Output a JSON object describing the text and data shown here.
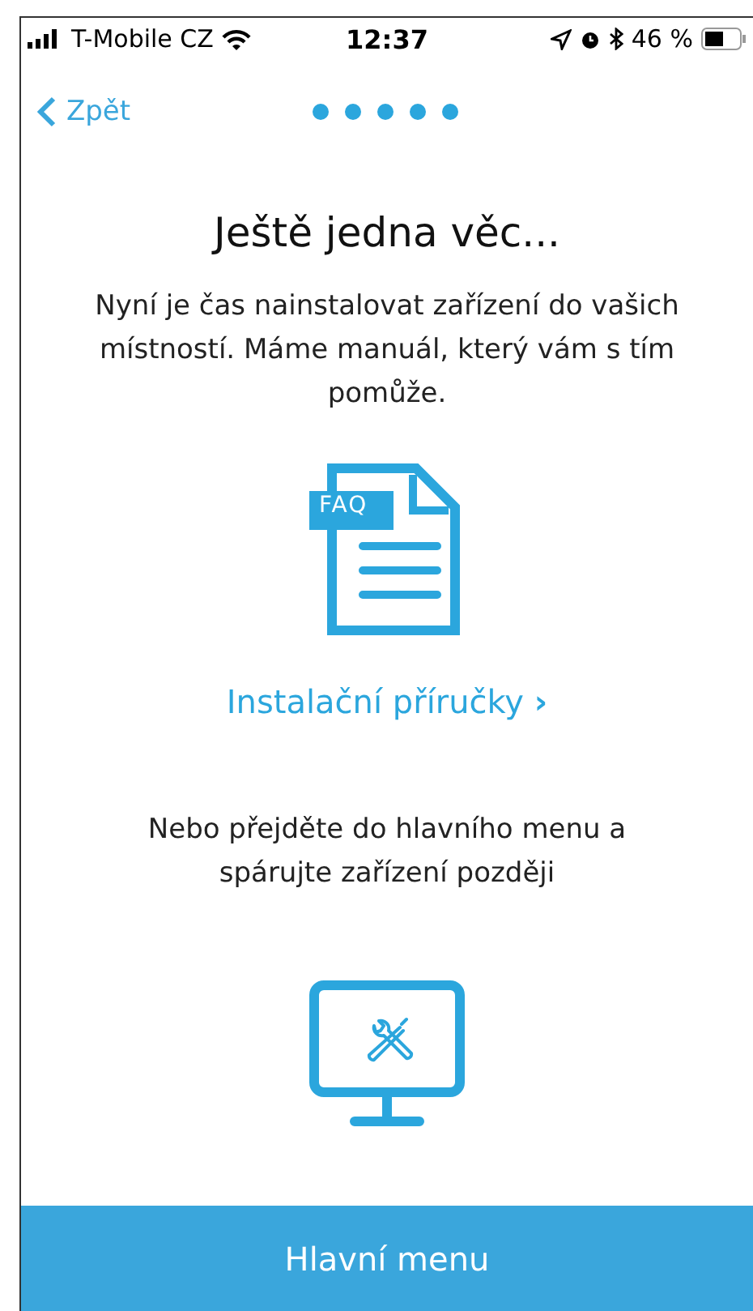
{
  "status_bar": {
    "carrier": "T-Mobile CZ",
    "time": "12:37",
    "battery": "46 %"
  },
  "nav": {
    "back": "Zpět",
    "steps": [
      {
        "completed": true
      },
      {
        "completed": true
      },
      {
        "completed": true
      },
      {
        "completed": true
      },
      {
        "completed": true
      }
    ]
  },
  "title": "Ještě jedna věc...",
  "intro": "Nyní je čas nainstalovat zařízení do vašich místností. Máme manuál, který vám s tím pomůže.",
  "faq_icon_label": "FAQ",
  "guide_link": "Instalační příručky",
  "guide_link_arrow": "›",
  "alternative": "Nebo přejděte do hlavního menu a spárujte zařízení později",
  "main_button": "Hlavní menu"
}
